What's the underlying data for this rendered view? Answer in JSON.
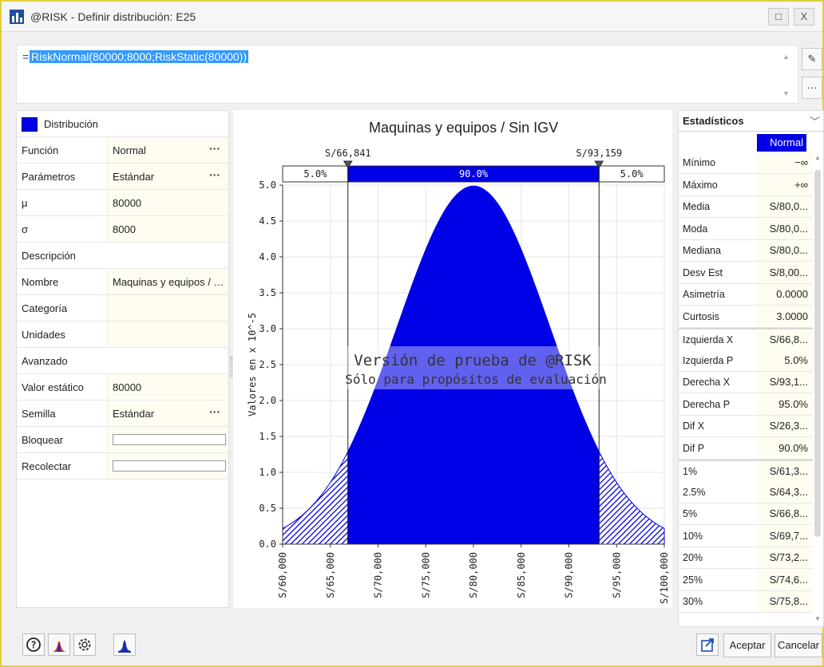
{
  "window": {
    "title": "@RISK - Definir distribución: E25",
    "restore_label": "□",
    "close_label": "X"
  },
  "formula": {
    "prefix": "=",
    "text": "RiskNormal(80000;8000;RiskStatic(80000))"
  },
  "side_buttons": {
    "edit_label": "✎",
    "more_label": "···"
  },
  "left_panel": {
    "header": "Distribución",
    "rows": [
      {
        "label": "Función",
        "value": "Normal",
        "dots": "···"
      },
      {
        "label": "Parámetros",
        "value": "Estándar",
        "dots": "···"
      },
      {
        "label": "μ",
        "value": "80000"
      },
      {
        "label": "σ",
        "value": "8000"
      }
    ],
    "section_desc": "Descripción",
    "desc_rows": [
      {
        "label": "Nombre",
        "value": "Maquinas y equipos / Sin IGV"
      },
      {
        "label": "Categoría",
        "value": ""
      },
      {
        "label": "Unidades",
        "value": ""
      }
    ],
    "section_adv": "Avanzado",
    "adv_rows": [
      {
        "label": "Valor estático",
        "value": "80000"
      },
      {
        "label": "Semilla",
        "value": "Estándar",
        "dots": "···"
      },
      {
        "label": "Bloquear"
      },
      {
        "label": "Recolectar"
      }
    ],
    "dist_color": "#0000e6"
  },
  "chart_data": {
    "type": "area",
    "title": "Maquinas y equipos / Sin IGV",
    "ylabel": "Valores en x 10^-5",
    "xlabel": "",
    "distribution": "Normal",
    "mean": 80000,
    "std": 8000,
    "xlim": [
      60000,
      100000
    ],
    "ylim": [
      0,
      5.0
    ],
    "yticks": [
      "0.0",
      "0.5",
      "1.0",
      "1.5",
      "2.0",
      "2.5",
      "3.0",
      "3.5",
      "4.0",
      "4.5",
      "5.0"
    ],
    "xticks": [
      "S/60,000",
      "S/65,000",
      "S/70,000",
      "S/75,000",
      "S/80,000",
      "S/85,000",
      "S/90,000",
      "S/95,000",
      "S/100,000"
    ],
    "left_marker": {
      "value": 66841,
      "label": "S/66,841"
    },
    "right_marker": {
      "value": 93159,
      "label": "S/93,159"
    },
    "band": {
      "left_pct": "5.0%",
      "middle_pct": "90.0%",
      "right_pct": "5.0%"
    },
    "fill_color": "#0000e6",
    "watermark_line1": "Versión de prueba de @RISK",
    "watermark_line2": "Sólo para propósitos de evaluación",
    "grid": true
  },
  "stats": {
    "title": "Estadísticos",
    "column": "Normal",
    "rows": [
      {
        "label": "Mínimo",
        "value": "−∞"
      },
      {
        "label": "Máximo",
        "value": "+∞"
      },
      {
        "label": "Media",
        "value": "S/80,0..."
      },
      {
        "label": "Moda",
        "value": "S/80,0..."
      },
      {
        "label": "Mediana",
        "value": "S/80,0..."
      },
      {
        "label": "Desv Est",
        "value": "S/8,00..."
      },
      {
        "label": "Asimetría",
        "value": "0.0000"
      },
      {
        "label": "Curtosis",
        "value": "3.0000"
      },
      {
        "label": "Izquierda X",
        "value": "S/66,8..."
      },
      {
        "label": "Izquierda P",
        "value": "5.0%"
      },
      {
        "label": "Derecha X",
        "value": "S/93,1..."
      },
      {
        "label": "Derecha P",
        "value": "95.0%"
      },
      {
        "label": "Dif X",
        "value": "S/26,3..."
      },
      {
        "label": "Dif P",
        "value": "90.0%"
      },
      {
        "label": "1%",
        "value": "S/61,3..."
      },
      {
        "label": "2.5%",
        "value": "S/64,3..."
      },
      {
        "label": "5%",
        "value": "S/66,8..."
      },
      {
        "label": "10%",
        "value": "S/69,7..."
      },
      {
        "label": "20%",
        "value": "S/73,2..."
      },
      {
        "label": "25%",
        "value": "S/74,6..."
      },
      {
        "label": "30%",
        "value": "S/75,8..."
      }
    ]
  },
  "bottom": {
    "help_label": "?",
    "accept_label": "Aceptar",
    "cancel_label": "Cancelar"
  }
}
